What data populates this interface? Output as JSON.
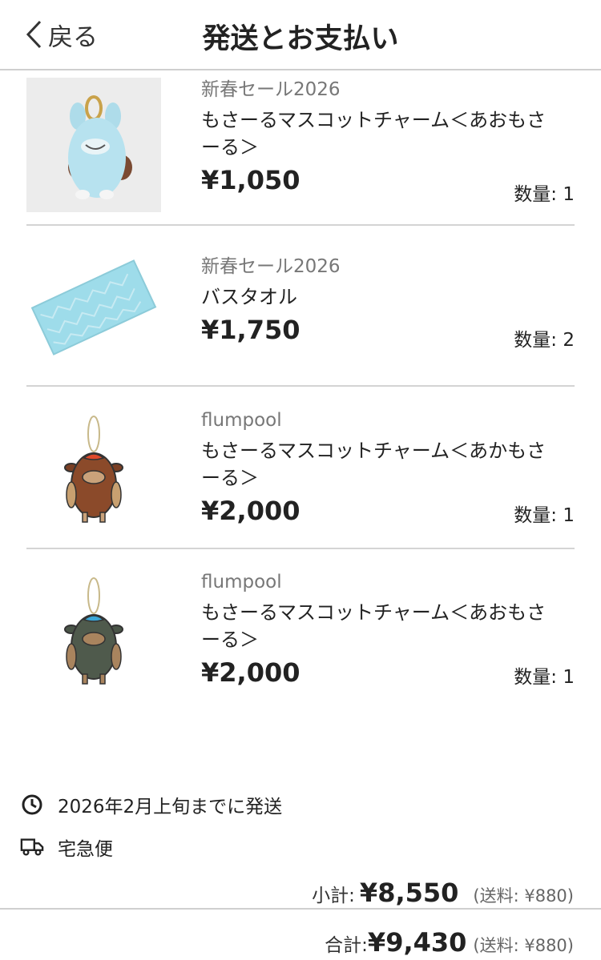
{
  "header": {
    "back_label": "戻る",
    "title": "発送とお支払い"
  },
  "items": [
    {
      "shop": "新春セール2026",
      "name": "もさーるマスコットチャーム＜あおもさーる＞",
      "name_lines": [
        "もさーるマスコットチャーム＜あおもさ",
        "ーる＞"
      ],
      "price": "¥1,050",
      "quantity": "数量: 1"
    },
    {
      "shop": "新春セール2026",
      "name": "バスタオル",
      "name_lines": [
        "バスタオル"
      ],
      "price": "¥1,750",
      "quantity": "数量: 2"
    },
    {
      "shop": "flumpool",
      "name": "もさーるマスコットチャーム＜あかもさーる＞",
      "name_lines": [
        "もさーるマスコットチャーム＜あかもさ",
        "ーる＞"
      ],
      "price": "¥2,000",
      "quantity": "数量: 1"
    },
    {
      "shop": "flumpool",
      "name": "もさーるマスコットチャーム＜あおもさーる＞",
      "name_lines": [
        "もさーるマスコットチャーム＜あおもさ",
        "ーる＞"
      ],
      "price": "¥2,000",
      "quantity": "数量: 1"
    }
  ],
  "shipping": {
    "date_text": "2026年2月上旬までに発送",
    "method_text": "宅急便"
  },
  "summary": {
    "subtotal_label": "小計:",
    "subtotal_value": "¥8,550",
    "subtotal_note": "(送料: ¥880)",
    "total_label": "合計:",
    "total_value": "¥9,430",
    "total_note": "(送料: ¥880)"
  },
  "icons": {
    "back": "chevron-left-icon",
    "clock": "clock-icon",
    "truck": "truck-icon"
  }
}
